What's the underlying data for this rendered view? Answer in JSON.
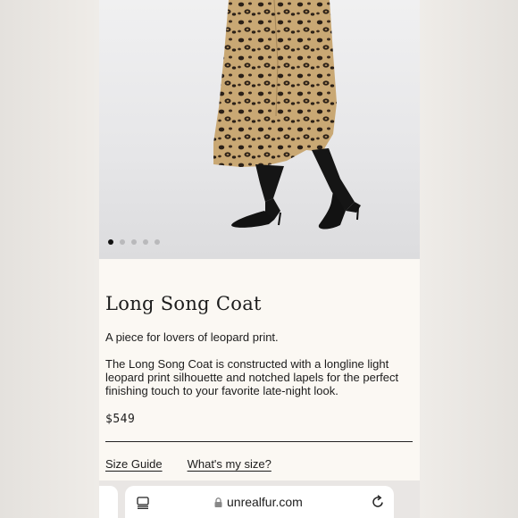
{
  "gallery": {
    "image_count": 5,
    "active_index": 0
  },
  "product": {
    "title": "Long Song Coat",
    "tagline": "A piece for lovers of leopard print.",
    "description": "The Long Song Coat is constructed with a longline light leopard print silhouette and notched lapels for the perfect finishing touch to your favorite late-night look.",
    "price": "$549"
  },
  "links": {
    "size_guide": "Size Guide",
    "whats_my_size": "What's my size?"
  },
  "browser": {
    "url": "unrealfur.com",
    "left_icon": "reader-icon",
    "lock_icon": "lock-icon",
    "reload_icon": "reload-icon"
  },
  "colors": {
    "page_bg": "#fbf8f3",
    "text": "#1c1c1c",
    "coat_base": "#c9a874",
    "coat_spots": "#2b2017",
    "boots": "#111111"
  }
}
